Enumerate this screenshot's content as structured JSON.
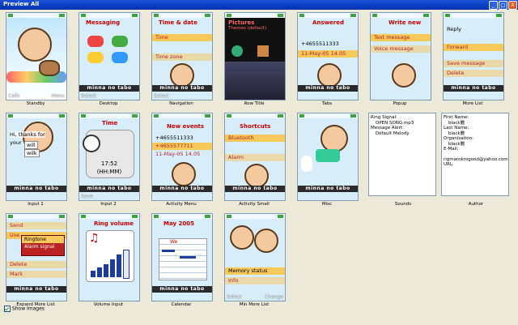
{
  "window": {
    "title": "Preview All",
    "buttons": [
      "_",
      "□",
      "X"
    ]
  },
  "footer": {
    "show_images_label": "Show Images",
    "show_images_checked": true
  },
  "brand_text": "minna no tabo",
  "rows": [
    [
      {
        "label": "Standby",
        "soft_left": "Calls",
        "soft_right": "Menu"
      },
      {
        "label": "Desktop",
        "header": "Messaging",
        "soft_left": "Select"
      },
      {
        "label": "Navigation",
        "header": "Time & date",
        "items": [
          "Time",
          "Time zone"
        ],
        "soft_left": "Select"
      },
      {
        "label": "Row Title",
        "header": "Pictures",
        "subheader": "Themes (default)"
      },
      {
        "label": "Tabs",
        "header": "Answered",
        "items": [
          "+4655511333",
          "11-May-05 14.05"
        ]
      },
      {
        "label": "Popup",
        "header": "Write new",
        "items": [
          "Text message",
          "Voice message"
        ]
      },
      {
        "label": "More List",
        "items": [
          "Reply",
          "Forward",
          "Save message",
          "Delete"
        ]
      }
    ],
    [
      {
        "label": "Input 1",
        "items": [
          "Hi, thanks for",
          "your",
          "will",
          "wilk"
        ]
      },
      {
        "label": "Input 2",
        "header": "Time",
        "items": [
          "17:52",
          "(HH:MM)"
        ],
        "soft_left": "Save"
      },
      {
        "label": "Activity Menu",
        "header": "New events",
        "items": [
          "+4655511333",
          "+4655577711",
          "11-May-05 14.05"
        ]
      },
      {
        "label": "Activity Small",
        "header": "Shortcuts",
        "items": [
          "Bluetooth",
          "Alarm"
        ]
      },
      {
        "label": "Misc"
      }
    ],
    [
      {
        "label": "Expand More List",
        "items": [
          "Send",
          "Use",
          "Ringtone",
          "Alarm signal",
          "Delete",
          "Mark"
        ]
      },
      {
        "label": "Volume Input",
        "header": "Ring volume"
      },
      {
        "label": "Calendar",
        "header": "May 2005",
        "items": [
          "We"
        ]
      },
      {
        "label": "Min More List",
        "items": [
          "Memory status",
          "Info"
        ],
        "soft_left": "Select",
        "soft_right": "Change"
      }
    ]
  ],
  "sounds": {
    "label": "Sounds",
    "lines": [
      "Ring Signal:",
      "OPEN SONG.mp3",
      "Message Alert:",
      "Default Melody"
    ]
  },
  "author": {
    "label": "Author",
    "lines": [
      "First Name:",
      "black麗",
      "Last Name:",
      "black麗",
      "Organisation:",
      "black麗",
      "E-Mail:",
      "",
      "rigmarokrogood@yahoo.com.tw",
      "URL:"
    ]
  },
  "colors": {
    "titlebar": "#0a3ec2",
    "highlight": "#f7c85a",
    "accent_red": "#c00"
  }
}
